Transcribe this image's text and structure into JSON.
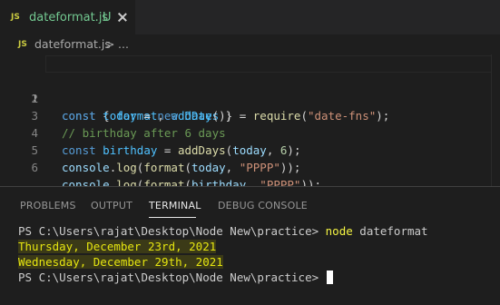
{
  "tab": {
    "icon": "JS",
    "filename": "dateformat.js",
    "flag": "U"
  },
  "breadcrumb": {
    "icon": "JS",
    "file": "dateformat.js",
    "separator": ">",
    "more": "..."
  },
  "editor": {
    "lines": [
      {
        "num": "1",
        "active": true
      },
      {
        "num": "2"
      },
      {
        "num": "3"
      },
      {
        "num": "4"
      },
      {
        "num": "5"
      },
      {
        "num": "6"
      }
    ],
    "code": {
      "l1": {
        "kw": "const",
        "open": " { ",
        "v1": "format",
        "comma": ", ",
        "v2": "addDays",
        "close": " } = ",
        "fn": "require",
        "p1": "(",
        "str": "\"date-fns\"",
        "p2": ");"
      },
      "l2": {
        "kw": "const",
        "sp": " ",
        "v": "today",
        "eq": " = ",
        "kw2": "new",
        "sp2": " ",
        "fn": "Date",
        "end": "();"
      },
      "l3": {
        "comment": "// birthday after 6 days"
      },
      "l4": {
        "kw": "const",
        "sp": " ",
        "v": "birthday",
        "eq": " = ",
        "fn": "addDays",
        "p1": "(",
        "arg": "today",
        "comma": ", ",
        "num": "6",
        "end": ");"
      },
      "l5": {
        "obj": "console",
        "dot": ".",
        "fn": "log",
        "p1": "(",
        "fn2": "format",
        "p2": "(",
        "arg": "today",
        "comma": ", ",
        "str": "\"PPPP\"",
        "end": "));"
      },
      "l6": {
        "obj": "console",
        "dot": ".",
        "fn": "log",
        "p1": "(",
        "fn2": "format",
        "p2": "(",
        "arg": "birthday",
        "comma": ", ",
        "str": "\"PPPP\"",
        "end": "));"
      }
    }
  },
  "panel": {
    "tabs": [
      "PROBLEMS",
      "OUTPUT",
      "TERMINAL",
      "DEBUG CONSOLE"
    ],
    "active_tab": "TERMINAL"
  },
  "terminal": {
    "prompt1": "PS C:\\Users\\rajat\\Desktop\\Node New\\practice> ",
    "command": "node",
    "command_arg": " dateformat",
    "output1": "Thursday, December 23rd, 2021",
    "output2": "Wednesday, December 29th, 2021",
    "prompt2": "PS C:\\Users\\rajat\\Desktop\\Node New\\practice> "
  }
}
